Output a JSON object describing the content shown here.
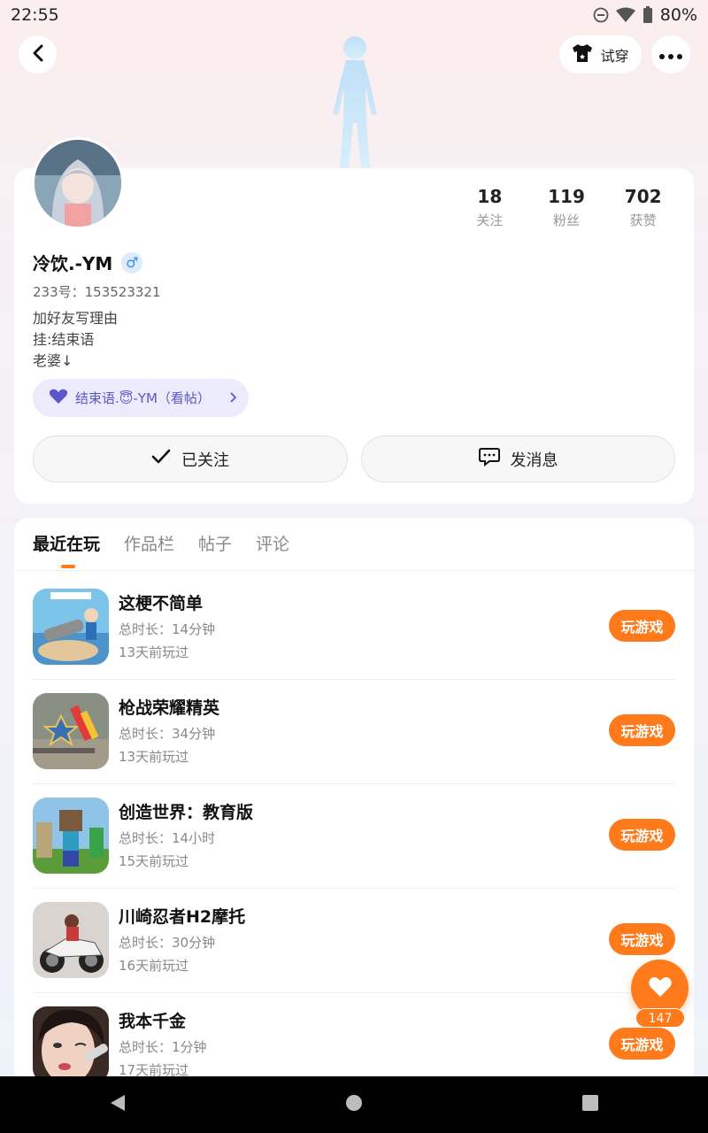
{
  "status_bar": {
    "time": "22:55",
    "battery": "80%",
    "icons": [
      "dnd-icon",
      "wifi-icon",
      "battery-icon"
    ]
  },
  "header": {
    "tryon_label": "试穿"
  },
  "profile": {
    "username": "冷饮.-YM",
    "gender_symbol": "♂",
    "uid": "233号：153523321",
    "bio": [
      "加好友写理由",
      "挂:结束语",
      "老婆↓"
    ],
    "link_pill": "结束语.😇-YM（看帖）",
    "stats": [
      {
        "num": "18",
        "label": "关注"
      },
      {
        "num": "119",
        "label": "粉丝"
      },
      {
        "num": "702",
        "label": "获赞"
      }
    ],
    "follow_label": "已关注",
    "message_label": "发消息"
  },
  "tabs": [
    {
      "label": "最近在玩",
      "active": true
    },
    {
      "label": "作品栏",
      "active": false
    },
    {
      "label": "帖子",
      "active": false
    },
    {
      "label": "评论",
      "active": false
    }
  ],
  "games": [
    {
      "name": "这梗不简单",
      "duration": "总时长：14分钟",
      "last_played": "13天前玩过",
      "button": "玩游戏"
    },
    {
      "name": "枪战荣耀精英",
      "duration": "总时长：34分钟",
      "last_played": "13天前玩过",
      "button": "玩游戏"
    },
    {
      "name": "创造世界：教育版",
      "duration": "总时长：14小时",
      "last_played": "15天前玩过",
      "button": "玩游戏"
    },
    {
      "name": "川崎忍者H2摩托",
      "duration": "总时长：30分钟",
      "last_played": "16天前玩过",
      "button": "玩游戏"
    },
    {
      "name": "我本千金",
      "duration": "总时长：1分钟",
      "last_played": "17天前玩过",
      "button": "玩游戏"
    }
  ],
  "like_fab": {
    "count": "147"
  },
  "colors": {
    "accent": "#ff7a1a",
    "pill_bg": "#ecebfc",
    "pill_text": "#5b56c9"
  }
}
